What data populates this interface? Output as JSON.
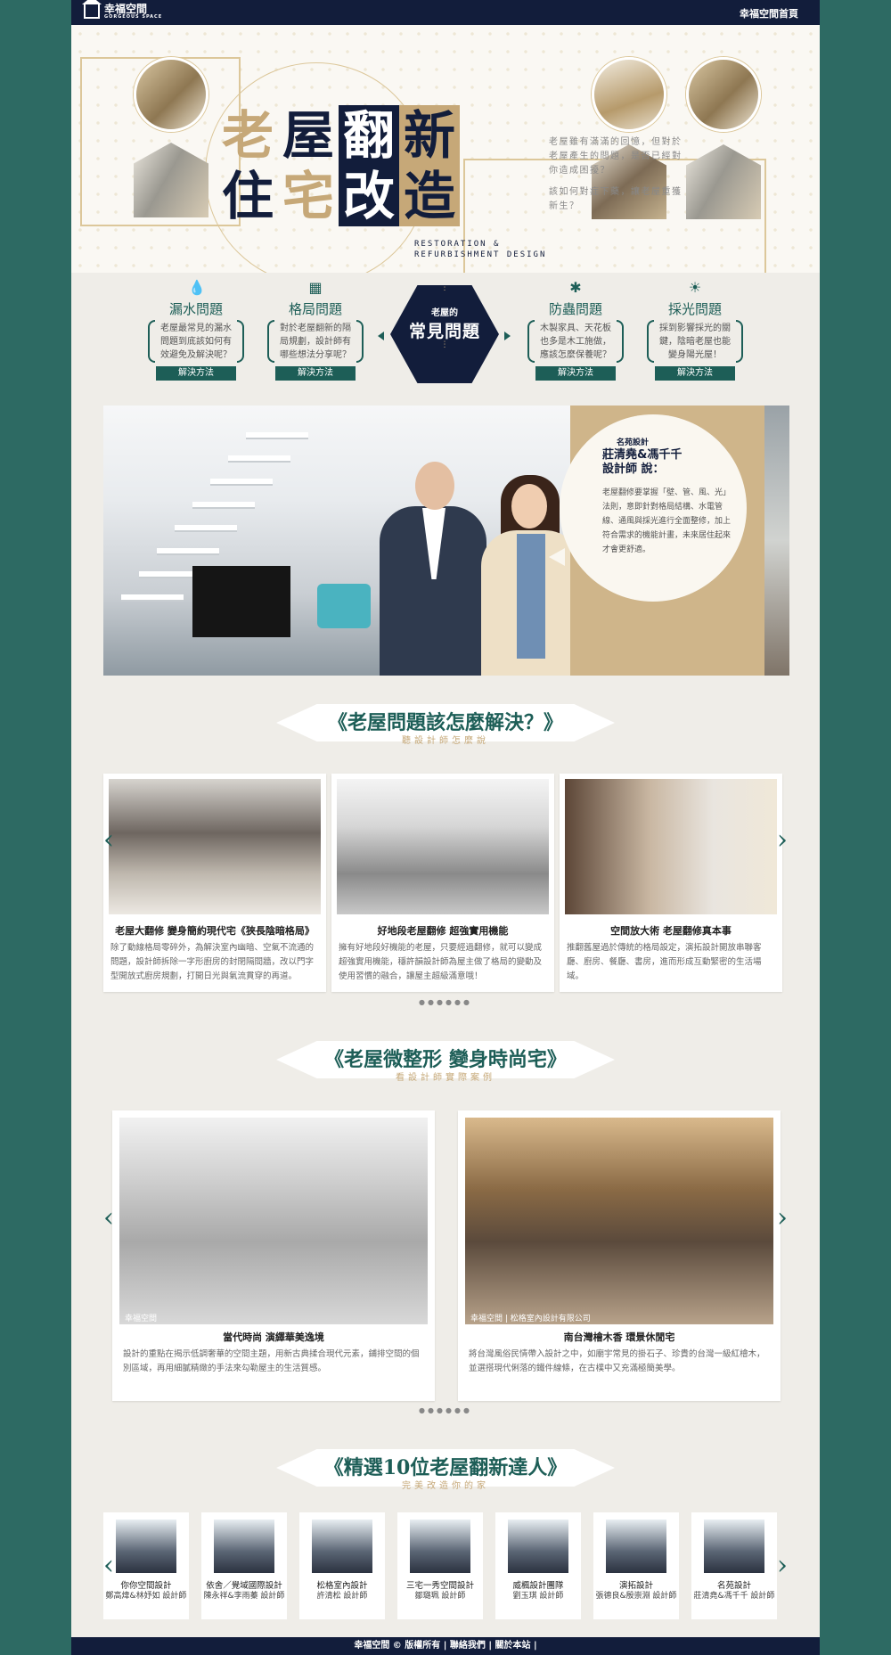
{
  "header": {
    "logo_text": "幸福空間",
    "logo_sub": "GORGEOUS SPACE",
    "home_link": "幸福空間首頁"
  },
  "hero": {
    "title_chars": [
      "老",
      "屋",
      "翻",
      "新",
      "住",
      "宅",
      "改",
      "造"
    ],
    "en_line1": "RESTORATION &",
    "en_line2": "REFURBISHMENT DESIGN",
    "desc_p1": "老屋雖有滿滿的回憶，但對於老屋產生的問題，是否已經對你造成困擾？",
    "desc_p2": "該如何對症下藥，讓老屋重獲新生？"
  },
  "problems": {
    "center_small": "老屋的",
    "center_big": "常見問題",
    "items": [
      {
        "title": "漏水問題",
        "desc": "老屋最常見的漏水問題到底該如何有效避免及解決呢？",
        "button": "解決方法",
        "icon": "water-drop-icon"
      },
      {
        "title": "格局問題",
        "desc": "對於老屋翻新的隔局規劃，設計師有哪些想法分享呢？",
        "button": "解決方法",
        "icon": "floorplan-icon"
      },
      {
        "title": "防蟲問題",
        "desc": "木製家具、天花板也多是木工施做，應該怎麼保養呢？",
        "button": "解決方法",
        "icon": "bug-icon"
      },
      {
        "title": "採光問題",
        "desc": "採到影響採光的關鍵，陰暗老屋也能變身陽光屋！",
        "button": "解決方法",
        "icon": "sun-icon"
      }
    ]
  },
  "designer": {
    "tag": "名苑設計",
    "name_line1": "莊清堯&馮千千",
    "name_line2": "設計師 說：",
    "body": "老屋翻修要掌握「壁、管、風、光」法則，意即針對格局結構、水電管線、通風與採光進行全面整修，加上符合需求的機能計畫，未來居住起來才會更舒適。"
  },
  "section1": {
    "title": "《老屋問題該怎麼解決？》",
    "subtitle": "聽設計師怎麼說",
    "cards": [
      {
        "title": "老屋大翻修 變身簡約現代宅《狹長陰暗格局》",
        "desc": "除了動線格局零碎外，為解決室內幽暗、空氣不流通的問題，設計師拆除一字形廚房的封閉隔間牆，改以門字型開放式廚房規劃，打開日光與氣流貫穿的再道。"
      },
      {
        "title": "好地段老屋翻修 超強實用機能",
        "desc": "擁有好地段好機能的老屋，只要經過翻修，就可以變成超強實用機能，穩許韻設計師為屋主做了格局的變動及使用習慣的融合，讓屋主超級滿意哦！"
      },
      {
        "title": "空間放大術 老屋翻修真本事",
        "desc": "推翻舊屋過於傳統的格局設定，演拓設計開放串聯客廳、廚房、餐廳、書房，進而形成互動緊密的生活場域。"
      }
    ],
    "pager": "●●●●●●"
  },
  "section2": {
    "title": "《老屋微整形 變身時尚宅》",
    "subtitle": "看設計師實際案例",
    "cards": [
      {
        "title": "當代時尚 演繹華美逸境",
        "desc": "設計的重點在揭示低調奢華的空間主題，用新古典揉合現代元素，鋪排空間的個別區域，再用細膩精緻的手法來勾勒屋主的生活質感。",
        "watermark": "幸福空間"
      },
      {
        "title": "南台灣檜木香 環景休閒宅",
        "desc": "將台灣風俗民情帶入設計之中，如廟宇常見的掛石子、珍貴的台灣一級紅檜木，並選搭現代俐落的鐵件線條，在古樸中又充滿極簡美學。",
        "watermark": "幸福空間 | 松格室內設計有限公司"
      }
    ],
    "pager": "●●●●●●"
  },
  "section3": {
    "title": "《精選10位老屋翻新達人》",
    "subtitle": "完美改造你的家",
    "experts": [
      {
        "company": "你你空間設計",
        "names": "鄭高煒&林妤如 設計師"
      },
      {
        "company": "依舍／覺域國際設計",
        "names": "陳永祥&李雨蓁 設計師"
      },
      {
        "company": "松格室內設計",
        "names": "許清松 設計師"
      },
      {
        "company": "三宅一秀空間設計",
        "names": "鄒璐珮 設計師"
      },
      {
        "company": "威楓設計團隊",
        "names": "劉玉琪 設計師"
      },
      {
        "company": "演拓設計",
        "names": "張德良&殷崇淵 設計師"
      },
      {
        "company": "名苑設計",
        "names": "莊清堯&馮千千 設計師"
      }
    ]
  },
  "footer": {
    "text": "幸福空間 © 版權所有 | 聯絡我們 | 關於本站 |"
  },
  "colors": {
    "navy": "#121d3b",
    "teal": "#1d5e57",
    "gold": "#c6a878",
    "side": "#2d6a63"
  }
}
